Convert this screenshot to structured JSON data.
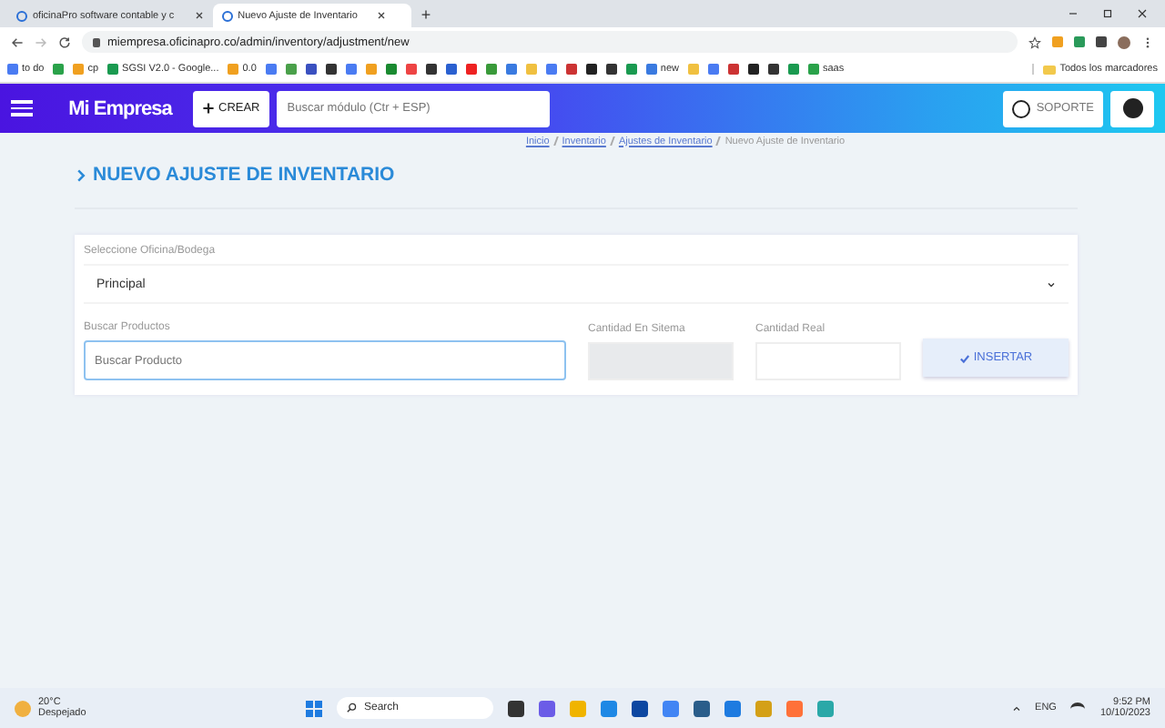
{
  "browser": {
    "tabs": [
      {
        "title": "oficinaPro software contable y c",
        "selected": false
      },
      {
        "title": "Nuevo Ajuste de Inventario",
        "selected": true
      }
    ],
    "new_tab": "+",
    "url": "miempresa.oficinapro.co/admin/inventory/adjustment/new",
    "bookmarks": [
      {
        "label": "to do"
      },
      {
        "label": "cp"
      },
      {
        "label": "SGSI V2.0 - Google..."
      },
      {
        "label": "0.0"
      },
      {
        "label": "new"
      },
      {
        "label": "saas"
      }
    ],
    "all_bookmarks": "Todos los marcadores"
  },
  "app": {
    "logo": "Mi Empresa",
    "create_button": "CREAR",
    "search": {
      "placeholder": "Buscar módulo (Ctr + ESP)"
    },
    "support_button": "SOPORTE",
    "breadcrumb": [
      "Inicio",
      "Inventario",
      "Ajustes de Inventario",
      "Nuevo Ajuste de Inventario"
    ],
    "page_title": "NUEVO AJUSTE DE INVENTARIO",
    "form": {
      "office_label": "Seleccione Oficina/Bodega",
      "office_value": "Principal",
      "product_label": "Buscar Productos",
      "product_search": {
        "placeholder": "Buscar Producto"
      },
      "system_qty_label": "Cantidad En Sitema",
      "real_qty_label": "Cantidad Real",
      "insert_button": "INSERTAR"
    }
  },
  "taskbar": {
    "temperature": "20°C",
    "weather": "Despejado",
    "search": "Search",
    "language": "ENG",
    "time": "9:52 PM",
    "date": "10/10/2023"
  }
}
